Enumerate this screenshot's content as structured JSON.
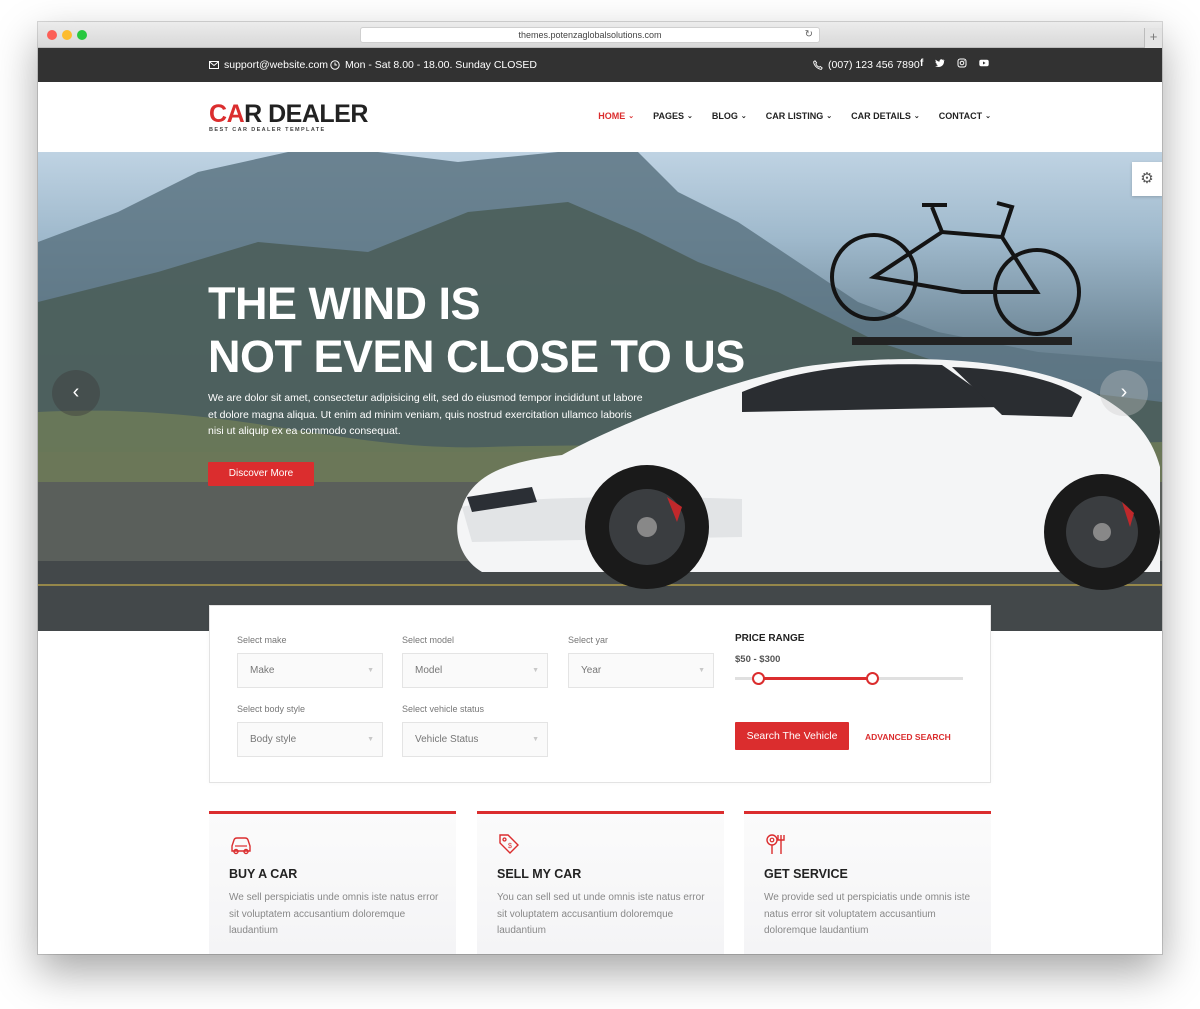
{
  "browser": {
    "url": "themes.potenzaglobalsolutions.com"
  },
  "topbar": {
    "email": "support@website.com",
    "hours": "Mon - Sat 8.00 - 18.00. Sunday CLOSED",
    "phone": "(007) 123 456 7890",
    "social": [
      "facebook-icon",
      "twitter-icon",
      "instagram-icon",
      "youtube-icon"
    ]
  },
  "logo": {
    "brand_first": "C",
    "brand_car_letter": "A",
    "brand_rest": "R DEALER",
    "tagline": "BEST CAR DEALER TEMPLATE"
  },
  "nav": {
    "items": [
      {
        "label": "HOME",
        "active": true
      },
      {
        "label": "PAGES",
        "active": false
      },
      {
        "label": "BLOG",
        "active": false
      },
      {
        "label": "CAR LISTING",
        "active": false
      },
      {
        "label": "CAR DETAILS",
        "active": false
      },
      {
        "label": "CONTACT",
        "active": false
      }
    ]
  },
  "hero": {
    "title_line1": "THE WIND IS",
    "title_line2": "NOT EVEN CLOSE TO US",
    "text": "We are dolor sit amet, consectetur adipisicing elit, sed do eiusmod tempor incididunt ut labore et dolore magna aliqua. Ut enim ad minim veniam, quis nostrud exercitation ullamco laboris nisi ut aliquip ex ea commodo consequat.",
    "button": "Discover More",
    "prev_arrow": "‹",
    "next_arrow": "›"
  },
  "search": {
    "make": {
      "label": "Select make",
      "value": "Make"
    },
    "model": {
      "label": "Select model",
      "value": "Model"
    },
    "year": {
      "label": "Select yar",
      "value": "Year"
    },
    "body": {
      "label": "Select body style",
      "value": "Body style"
    },
    "status": {
      "label": "Select vehicle status",
      "value": "Vehicle Status"
    },
    "price_title": "PRICE RANGE",
    "price_value": "$50 - $300",
    "price_range_fraction": [
      0.1,
      0.6
    ],
    "button": "Search The Vehicle",
    "advanced": "ADVANCED SEARCH"
  },
  "services": [
    {
      "title": "BUY A CAR",
      "icon": "car-icon",
      "desc": "We sell perspiciatis unde omnis iste natus error sit voluptatem accusantium doloremque laudantium"
    },
    {
      "title": "SELL MY CAR",
      "icon": "price-tag-icon",
      "desc": "You can sell sed ut unde omnis iste natus error sit voluptatem accusantium doloremque laudantium"
    },
    {
      "title": "GET SERVICE",
      "icon": "wrench-icon",
      "desc": "We provide sed ut perspiciatis unde omnis iste natus error sit voluptatem accusantium doloremque laudantium"
    }
  ],
  "colors": {
    "accent": "#db2d2e",
    "topbar": "#323232"
  }
}
